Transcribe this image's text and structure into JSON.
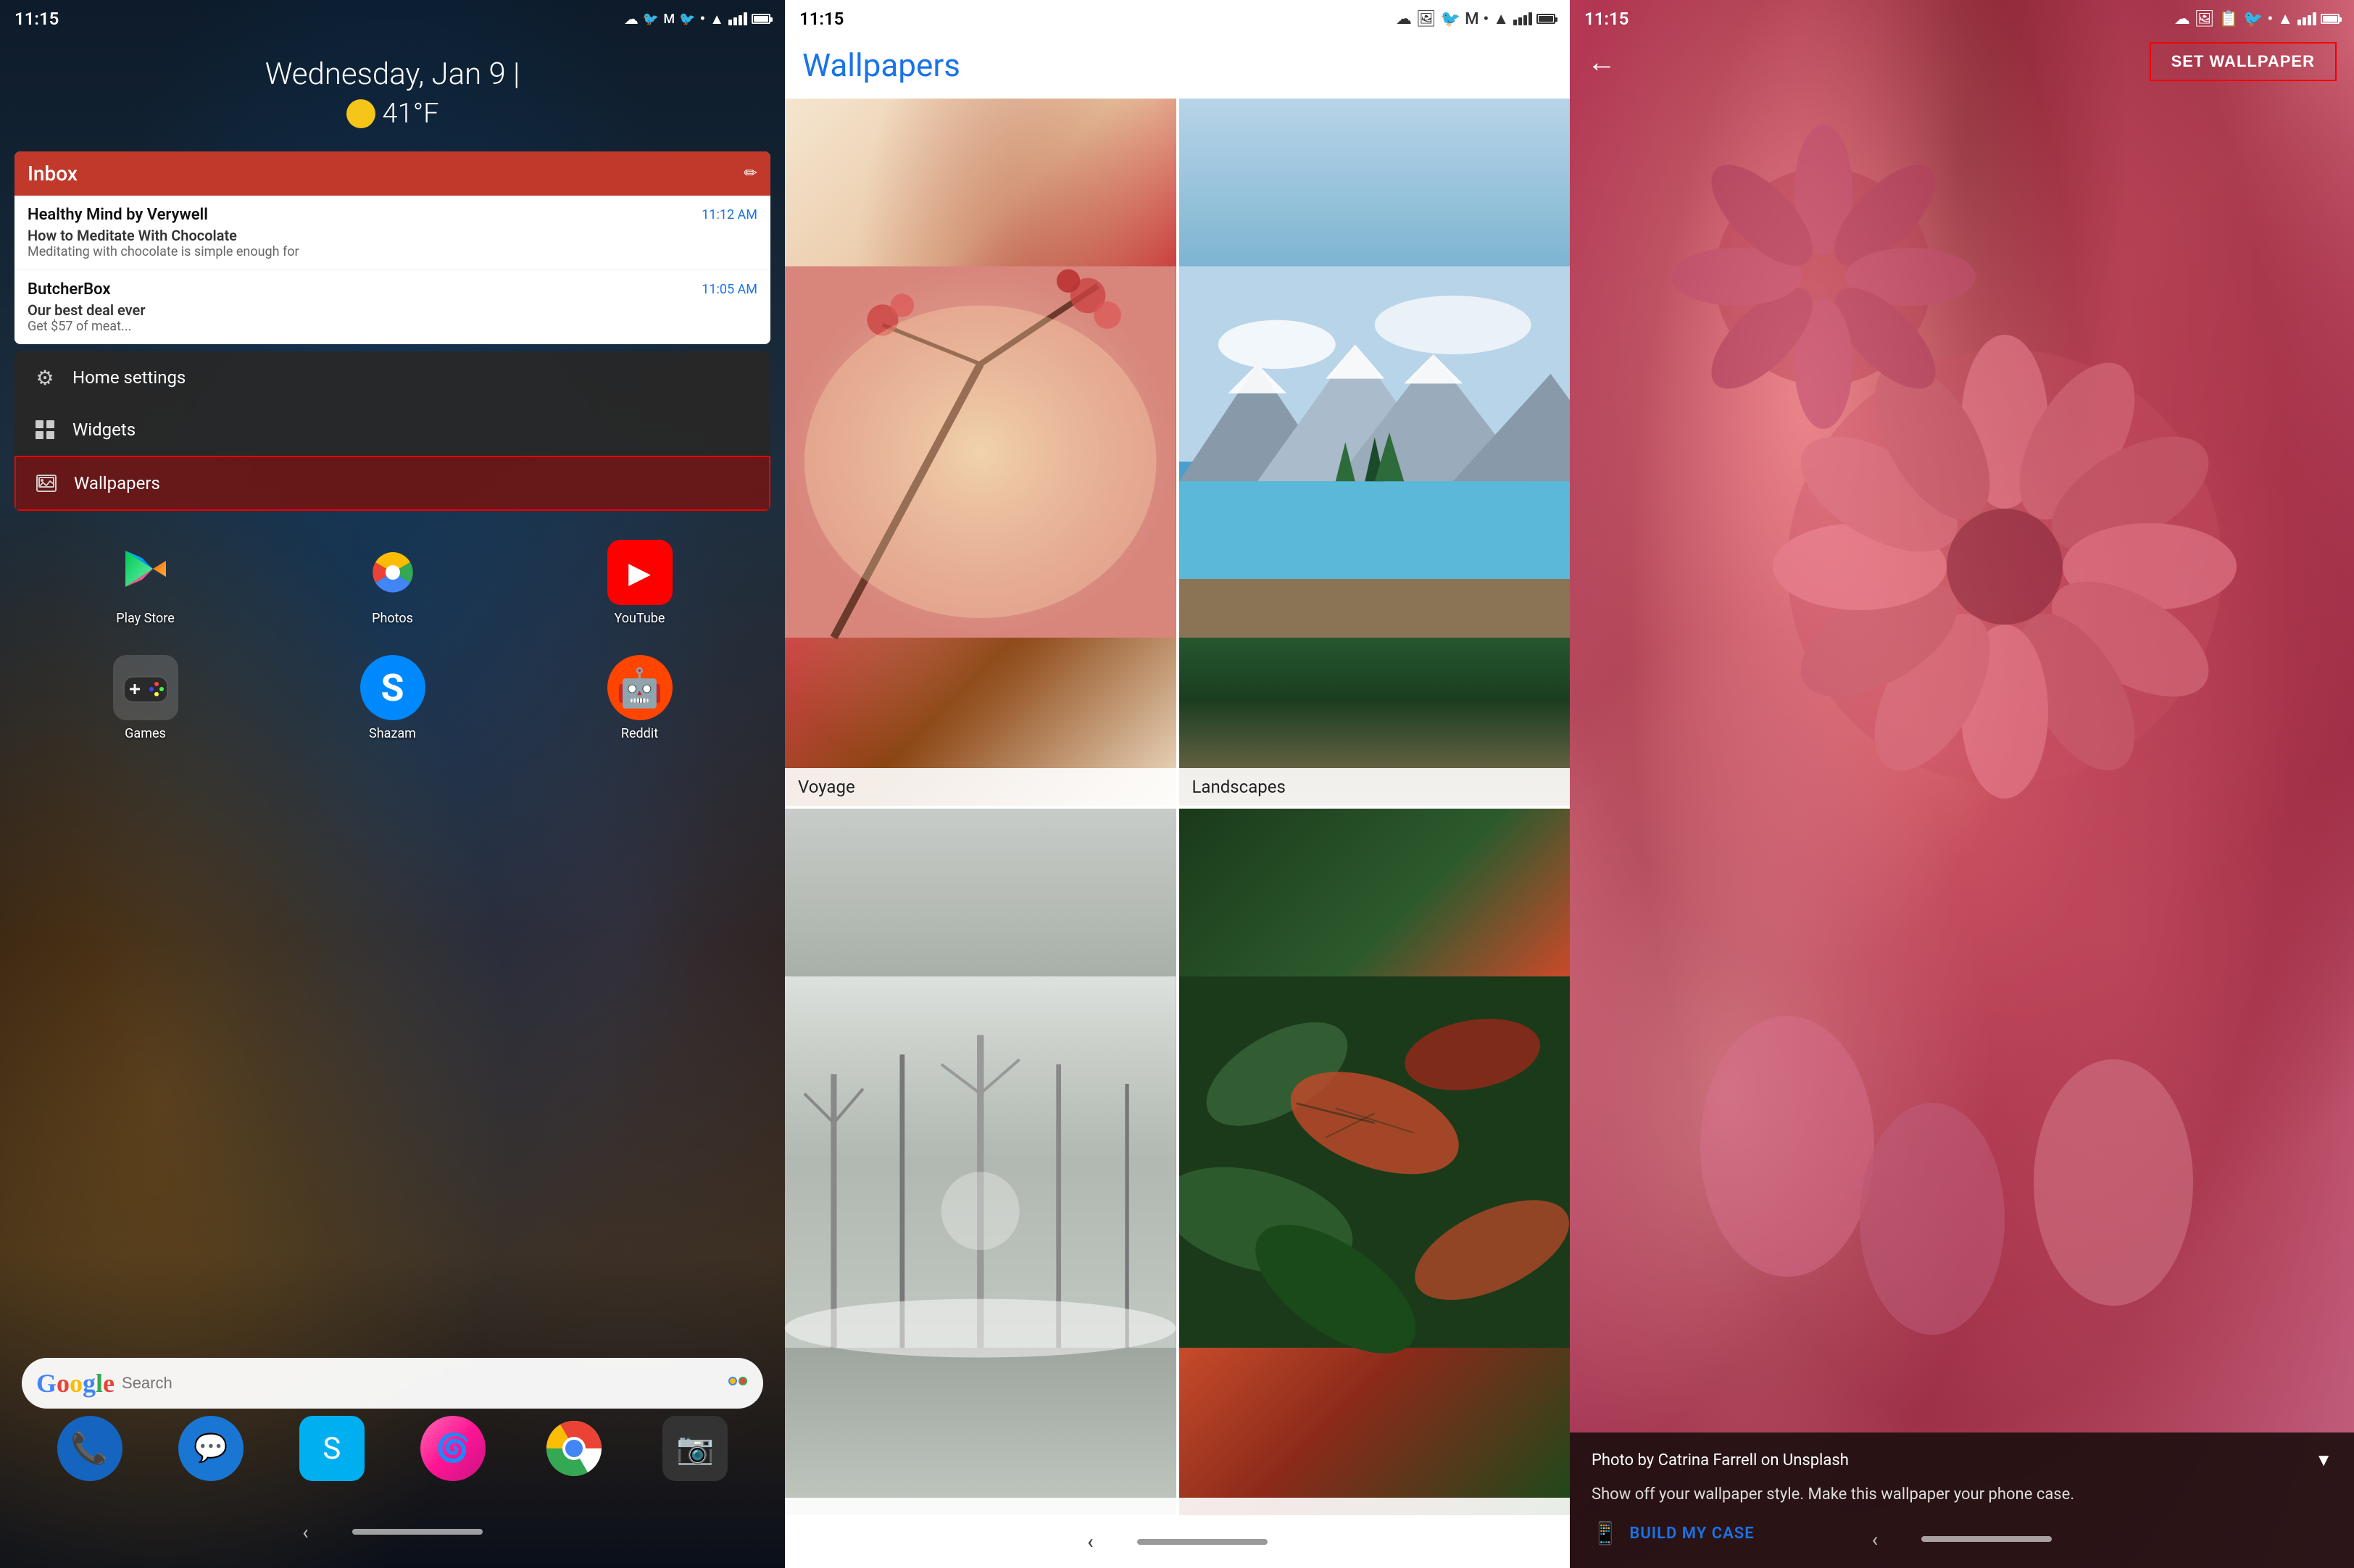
{
  "panel1": {
    "status": {
      "time": "11:15"
    },
    "date": "Wednesday, Jan 9",
    "separator": "|",
    "temp": "41°F",
    "inbox": {
      "title": "Inbox",
      "items": [
        {
          "sender": "Healthy Mind by Verywell",
          "time": "11:12 AM",
          "subject": "How to Meditate With Chocolate",
          "preview": "Meditating with chocolate is simple enough for"
        },
        {
          "sender": "ButcherBox",
          "time": "11:05 AM",
          "subject": "Our best deal ever",
          "preview": "Get $57 of meat..."
        }
      ]
    },
    "context_menu": {
      "items": [
        {
          "label": "Home settings",
          "icon": "⚙"
        },
        {
          "label": "Widgets",
          "icon": "⊞"
        },
        {
          "label": "Wallpapers",
          "icon": "🖼",
          "active": true
        }
      ]
    },
    "apps_row1": [
      {
        "label": "Play Store"
      },
      {
        "label": "Photos"
      }
    ],
    "apps_row2": [
      {
        "label": "Games"
      },
      {
        "label": "",
        "icon": "Shazam"
      },
      {
        "label": "Reddit"
      }
    ],
    "search_placeholder": "Search"
  },
  "panel2": {
    "status": {
      "time": "11:15"
    },
    "title": "Wallpapers",
    "tiles": [
      {
        "label": "Voyage",
        "position": "top-left"
      },
      {
        "label": "Landscapes",
        "position": "top-right"
      },
      {
        "label": "",
        "position": "bottom-left"
      },
      {
        "label": "",
        "position": "bottom-right"
      }
    ]
  },
  "panel3": {
    "status": {
      "time": "11:15"
    },
    "back_label": "←",
    "set_wallpaper_label": "SET WALLPAPER",
    "photo_credit": "Photo by Catrina Farrell on Unsplash",
    "promo_text": "Show off your wallpaper style. Make this wallpaper your phone case.",
    "build_case_label": "BUILD MY CASE"
  }
}
